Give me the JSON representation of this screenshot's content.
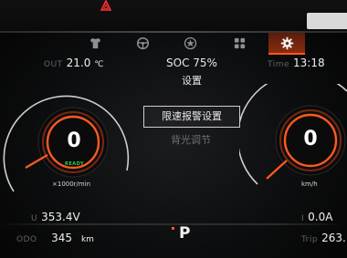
{
  "top_bar": {
    "hazard_icon": "hazard-warning-icon",
    "hazard_color": "#ff3030"
  },
  "tabs": [
    {
      "icon": "shirt-icon",
      "active": false
    },
    {
      "icon": "steering-wheel-icon",
      "active": false
    },
    {
      "icon": "star-badge-icon",
      "active": false
    },
    {
      "icon": "apps-grid-icon",
      "active": false
    },
    {
      "icon": "gear-icon",
      "active": true
    }
  ],
  "out_temp": {
    "label": "OUT",
    "value": "21.0",
    "unit": "℃"
  },
  "soc": "SOC 75%",
  "time": {
    "label": "Time",
    "value": "13:18"
  },
  "page_title": "设置",
  "menu": {
    "items": [
      {
        "label": "限速报警设置",
        "selected": true
      },
      {
        "label": "背光调节",
        "selected": false
      }
    ]
  },
  "left_gauge": {
    "value": "0",
    "status": "READY",
    "unit": "×1000r/min",
    "status_color": "#21d24a"
  },
  "right_gauge": {
    "value": "0",
    "unit": "km/h"
  },
  "voltage": {
    "label": "U",
    "value": "353.4V"
  },
  "current": {
    "label": "I",
    "value": "0.0A"
  },
  "odo": {
    "label": "ODO",
    "value": "345",
    "unit": "km"
  },
  "trip": {
    "label": "Trip",
    "value": "263."
  },
  "gear": "P",
  "accent_color": "#ff5a1e"
}
